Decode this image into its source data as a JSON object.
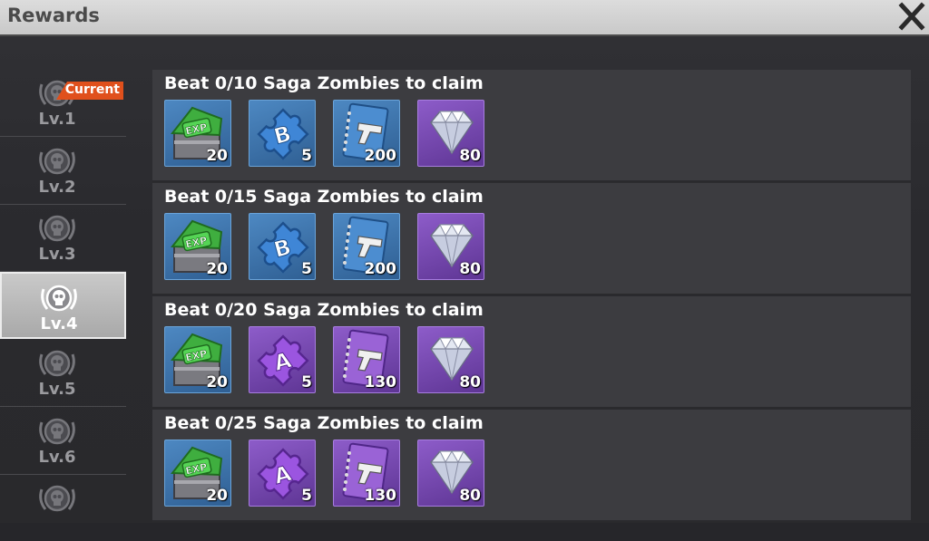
{
  "window": {
    "title": "Rewards"
  },
  "icons": {
    "close": "close-icon",
    "level_badge": "skull-badge-icon"
  },
  "colors": {
    "current_tag": "#e0501c",
    "rarity_blue": "#3d74ad",
    "rarity_purple": "#7447ad"
  },
  "sidebar": {
    "current_label": "Current",
    "selected_index": 3,
    "levels": [
      {
        "label": "Lv.1"
      },
      {
        "label": "Lv.2"
      },
      {
        "label": "Lv.3"
      },
      {
        "label": "Lv.4"
      },
      {
        "label": "Lv.5"
      },
      {
        "label": "Lv.6"
      }
    ]
  },
  "rewards": [
    {
      "task": "Beat 0/10 Saga Zombies to claim",
      "items": [
        {
          "icon": "exp-chest-icon",
          "rarity": "blue",
          "qty": "20"
        },
        {
          "icon": "puzzle-b-icon",
          "rarity": "blue",
          "qty": "5"
        },
        {
          "icon": "pistol-manual-icon",
          "rarity": "blue",
          "qty": "200"
        },
        {
          "icon": "diamond-icon",
          "rarity": "purple",
          "qty": "80"
        }
      ]
    },
    {
      "task": "Beat 0/15 Saga Zombies to claim",
      "items": [
        {
          "icon": "exp-chest-icon",
          "rarity": "blue",
          "qty": "20"
        },
        {
          "icon": "puzzle-b-icon",
          "rarity": "blue",
          "qty": "5"
        },
        {
          "icon": "pistol-manual-icon",
          "rarity": "blue",
          "qty": "200"
        },
        {
          "icon": "diamond-icon",
          "rarity": "purple",
          "qty": "80"
        }
      ]
    },
    {
      "task": "Beat 0/20 Saga Zombies to claim",
      "items": [
        {
          "icon": "exp-chest-icon",
          "rarity": "blue",
          "qty": "20"
        },
        {
          "icon": "puzzle-a-icon",
          "rarity": "purple",
          "qty": "5"
        },
        {
          "icon": "pistol-manual-icon",
          "rarity": "purple",
          "qty": "130"
        },
        {
          "icon": "diamond-icon",
          "rarity": "purple",
          "qty": "80"
        }
      ]
    },
    {
      "task": "Beat 0/25 Saga Zombies to claim",
      "items": [
        {
          "icon": "exp-chest-icon",
          "rarity": "blue",
          "qty": "20"
        },
        {
          "icon": "puzzle-a-icon",
          "rarity": "purple",
          "qty": "5"
        },
        {
          "icon": "pistol-manual-icon",
          "rarity": "purple",
          "qty": "130"
        },
        {
          "icon": "diamond-icon",
          "rarity": "purple",
          "qty": "80"
        }
      ]
    }
  ]
}
